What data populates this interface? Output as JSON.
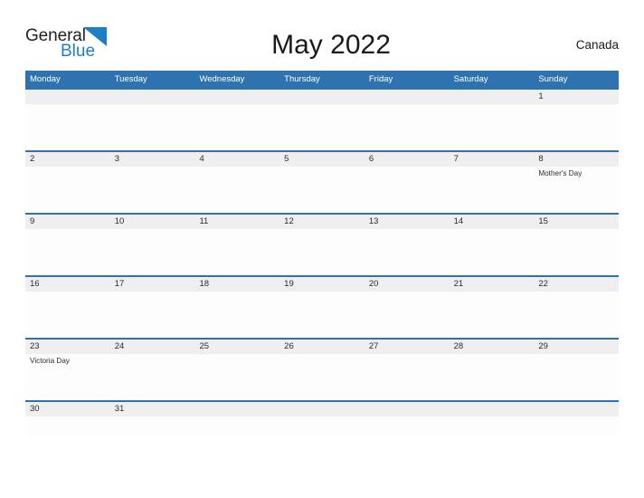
{
  "brand": {
    "name_part1": "General",
    "name_part2": "Blue",
    "flag_icon": "blue-triangle-flag-icon",
    "color_dark": "#231f20",
    "color_blue": "#1d7fc3"
  },
  "header": {
    "title": "May 2022",
    "country": "Canada"
  },
  "colors": {
    "header_blue": "#2e72b0",
    "row_divider_blue": "#2e72b0",
    "number_band_gray": "#efefef",
    "cell_white": "#fdfdfd",
    "text_dark": "#2b2b2b"
  },
  "calendar": {
    "month": "May",
    "year": "2022",
    "day_headers": [
      "Monday",
      "Tuesday",
      "Wednesday",
      "Thursday",
      "Friday",
      "Saturday",
      "Sunday"
    ],
    "weeks": [
      {
        "days": [
          {
            "number": "",
            "event": ""
          },
          {
            "number": "",
            "event": ""
          },
          {
            "number": "",
            "event": ""
          },
          {
            "number": "",
            "event": ""
          },
          {
            "number": "",
            "event": ""
          },
          {
            "number": "",
            "event": ""
          },
          {
            "number": "1",
            "event": ""
          }
        ]
      },
      {
        "days": [
          {
            "number": "2",
            "event": ""
          },
          {
            "number": "3",
            "event": ""
          },
          {
            "number": "4",
            "event": ""
          },
          {
            "number": "5",
            "event": ""
          },
          {
            "number": "6",
            "event": ""
          },
          {
            "number": "7",
            "event": ""
          },
          {
            "number": "8",
            "event": "Mother's Day"
          }
        ]
      },
      {
        "days": [
          {
            "number": "9",
            "event": ""
          },
          {
            "number": "10",
            "event": ""
          },
          {
            "number": "11",
            "event": ""
          },
          {
            "number": "12",
            "event": ""
          },
          {
            "number": "13",
            "event": ""
          },
          {
            "number": "14",
            "event": ""
          },
          {
            "number": "15",
            "event": ""
          }
        ]
      },
      {
        "days": [
          {
            "number": "16",
            "event": ""
          },
          {
            "number": "17",
            "event": ""
          },
          {
            "number": "18",
            "event": ""
          },
          {
            "number": "19",
            "event": ""
          },
          {
            "number": "20",
            "event": ""
          },
          {
            "number": "21",
            "event": ""
          },
          {
            "number": "22",
            "event": ""
          }
        ]
      },
      {
        "days": [
          {
            "number": "23",
            "event": "Victoria Day"
          },
          {
            "number": "24",
            "event": ""
          },
          {
            "number": "25",
            "event": ""
          },
          {
            "number": "26",
            "event": ""
          },
          {
            "number": "27",
            "event": ""
          },
          {
            "number": "28",
            "event": ""
          },
          {
            "number": "29",
            "event": ""
          }
        ]
      },
      {
        "days": [
          {
            "number": "30",
            "event": ""
          },
          {
            "number": "31",
            "event": ""
          },
          {
            "number": "",
            "event": ""
          },
          {
            "number": "",
            "event": ""
          },
          {
            "number": "",
            "event": ""
          },
          {
            "number": "",
            "event": ""
          },
          {
            "number": "",
            "event": ""
          }
        ]
      }
    ]
  }
}
